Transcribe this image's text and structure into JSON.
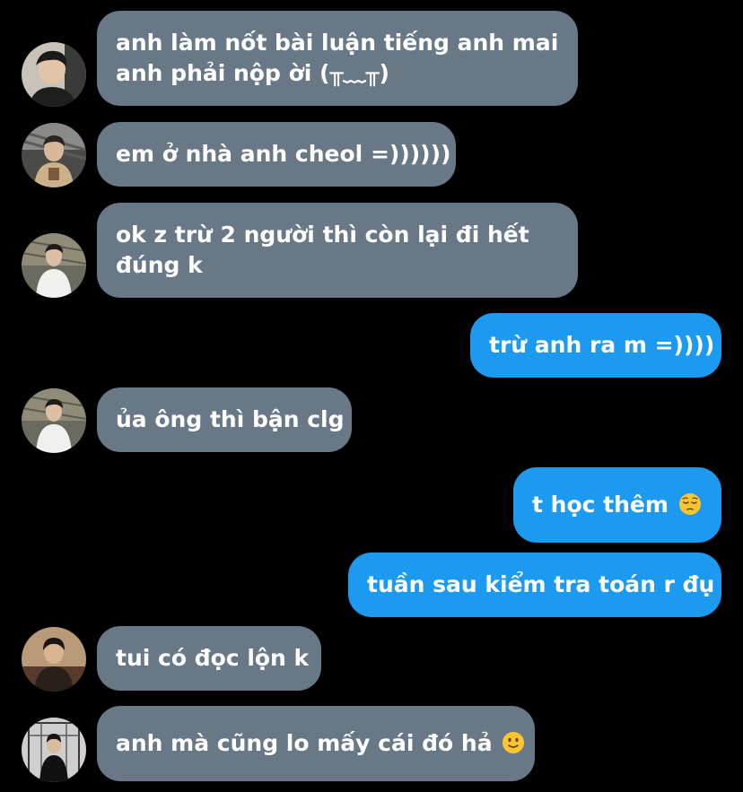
{
  "colors": {
    "background": "#000000",
    "incoming_bubble": "#687887",
    "outgoing_bubble": "#1c9af0",
    "text": "#ffffff"
  },
  "messages": [
    {
      "side": "incoming",
      "lines": [
        "anh làm nốt bài luận tiếng anh mai",
        "anh phải nộp ời (╥﹏╥)"
      ],
      "avatar": "avatar-person-1"
    },
    {
      "side": "incoming",
      "lines": [
        "em ở nhà anh cheol =))))))"
      ],
      "avatar": "avatar-person-2"
    },
    {
      "side": "incoming",
      "lines": [
        "ok z trừ 2 người thì còn lại đi hết",
        "đúng k"
      ],
      "avatar": "avatar-person-3"
    },
    {
      "side": "outgoing",
      "lines": [
        "trừ anh ra m =))))"
      ]
    },
    {
      "side": "incoming",
      "lines": [
        "ủa ông thì bận clg"
      ],
      "avatar": "avatar-person-3"
    },
    {
      "side": "outgoing",
      "lines": [
        "t học thêm"
      ],
      "emoji": "pensive-face-emoji"
    },
    {
      "side": "outgoing",
      "lines": [
        "tuần sau kiểm tra toán r đụ"
      ]
    },
    {
      "side": "incoming",
      "lines": [
        "tui có đọc lộn k"
      ],
      "avatar": "avatar-person-4"
    },
    {
      "side": "incoming",
      "lines": [
        "anh mà cũng lo mấy cái đó hả"
      ],
      "emoji": "slightly-smiling-face-emoji",
      "avatar": "avatar-person-5"
    }
  ]
}
